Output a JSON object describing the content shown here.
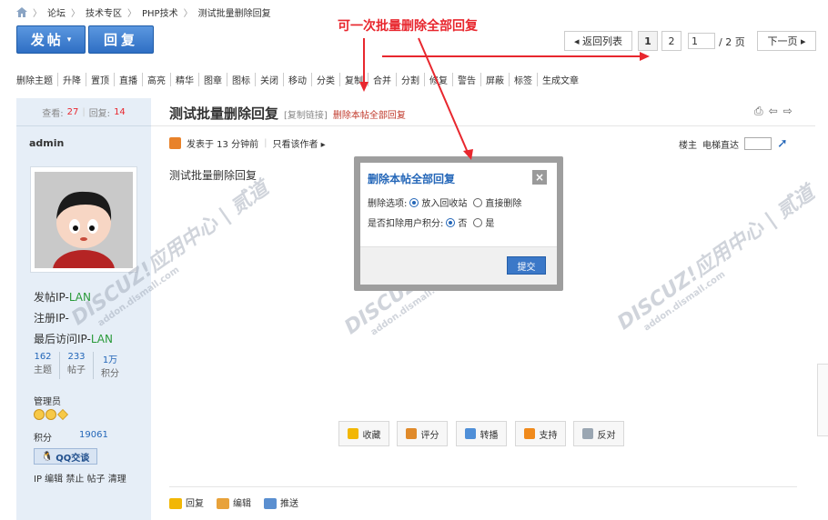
{
  "breadcrumb": [
    "论坛",
    "技术专区",
    "PHP技术",
    "测试批量删除回复"
  ],
  "toolbar": {
    "post_label": "发帖",
    "reply_label": "回复"
  },
  "annotation": "可一次批量删除全部回复",
  "pager": {
    "back": "◂ 返回列表",
    "page1": "1",
    "page2": "2",
    "page_input": "1",
    "total": "/ 2 页",
    "next": "下一页 ▸"
  },
  "mod_actions": [
    "删除主题",
    "升降",
    "置顶",
    "直播",
    "高亮",
    "精华",
    "图章",
    "图标",
    "关闭",
    "移动",
    "分类",
    "复制",
    "合并",
    "分割",
    "修复",
    "警告",
    "屏蔽",
    "标签",
    "生成文章"
  ],
  "thread": {
    "views_label": "查看:",
    "views": "27",
    "replies_label": "回复:",
    "replies": "14",
    "title": "测试批量删除回复",
    "copy_link": "[复制链接]",
    "delete_all": "删除本帖全部回复"
  },
  "author": {
    "name": "admin",
    "post_ip_label": "发帖IP-",
    "post_ip": "LAN",
    "reg_ip_label": "注册IP-",
    "last_ip_label": "最后访问IP-",
    "last_ip": "LAN",
    "stats": [
      {
        "value": "162",
        "label": "主题"
      },
      {
        "value": "233",
        "label": "帖子"
      },
      {
        "value": "1万",
        "label": "积分"
      }
    ],
    "group": "管理员",
    "score_label": "积分",
    "score": "19061",
    "qq_label": "QQ交谈",
    "admin_links": "IP 编辑 禁止 帖子 清理"
  },
  "post": {
    "posted": "发表于 13 分钟前",
    "only_author": "只看该作者 ▸",
    "owner_label": "楼主",
    "floor_label": "电梯直达",
    "body": "测试批量删除回复"
  },
  "actions": [
    "收藏",
    "评分",
    "转播",
    "支持",
    "反对"
  ],
  "footer_actions": [
    "回复",
    "编辑",
    "推送"
  ],
  "modal": {
    "title": "删除本帖全部回复",
    "close": "×",
    "option_label": "删除选项:",
    "opt_recycle": "放入回收站",
    "opt_direct": "直接删除",
    "credit_label": "是否扣除用户积分:",
    "credit_no": "否",
    "credit_yes": "是",
    "submit": "提交"
  },
  "watermark": {
    "brand": "DISCUZ!应用中心 | 贰道",
    "domain": "addon.dismall.com"
  },
  "colors": {
    "accent": "#e8272e",
    "primary": "#2f6fc4",
    "link": "#2366b8",
    "lan": "#2a9a3a"
  }
}
